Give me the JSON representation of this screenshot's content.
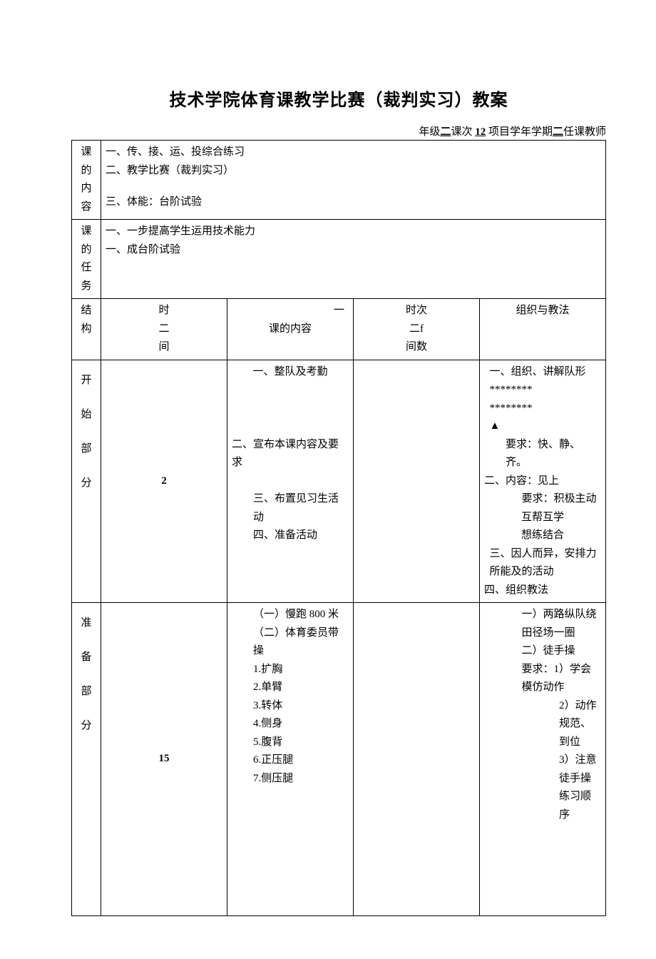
{
  "title": "技术学院体育课教学比赛（裁判实习）教案",
  "meta": {
    "line": "年级二课次 12 项目学年学期二任课教师",
    "grade_label": "年级",
    "grade_value": "二",
    "lesson_label": "课次",
    "lesson_value": "12",
    "project_label": "项目学年学期",
    "project_value": "二",
    "teacher_label": "任课教师"
  },
  "labels": {
    "course_content": "课的内容",
    "course_task": "课的任务",
    "structure": "结构",
    "time": "时间",
    "content": "课的内容",
    "time_count": "时次二f间数",
    "method": "组织与教法",
    "start_section": "开始部分",
    "prep_section": "准备部分"
  },
  "course_content": {
    "l1": "一、传、接、运、投综合练习",
    "l2": "二、教学比赛（裁判实习）",
    "l3": "三、体能：台阶试验"
  },
  "course_task": {
    "l1": "一、一步提高学生运用技术能力",
    "l2": "一、成台阶试验"
  },
  "start": {
    "time": "2",
    "content": {
      "c1": "一、整队及考勤",
      "c2": "二、宣布本课内容及要求",
      "c3": "三、布置见习生活动",
      "c4": "四、准备活动"
    },
    "method": {
      "m1": "一、组织、讲解队形",
      "m2": "********",
      "m3": "********",
      "m4": "▲",
      "m5": "要求：快、静、齐。",
      "m6": "二、内容：见上",
      "m7": "要求：积极主动",
      "m8": "互帮互学",
      "m9": "想练结合",
      "m10": "三、因人而异，安排力所能及的活动",
      "m11": "四、组织教法"
    }
  },
  "prep": {
    "time": "15",
    "content": {
      "c1": "（一）慢跑 800 米",
      "c2": "（二）体育委员带操",
      "c3": "1.扩胸",
      "c4": "2.单臂",
      "c5": "3.转体",
      "c6": "4.侧身",
      "c7": "5.腹背",
      "c8": "6.正压腿",
      "c9": "7.侧压腿"
    },
    "method": {
      "m1": "一）两路纵队绕田径场一圈",
      "m2": "二）徒手操",
      "m3": "要求：1）学会模仿动作",
      "m4": "2）动作规范、到位",
      "m5": "3）注意徒手操练习顺序"
    }
  }
}
